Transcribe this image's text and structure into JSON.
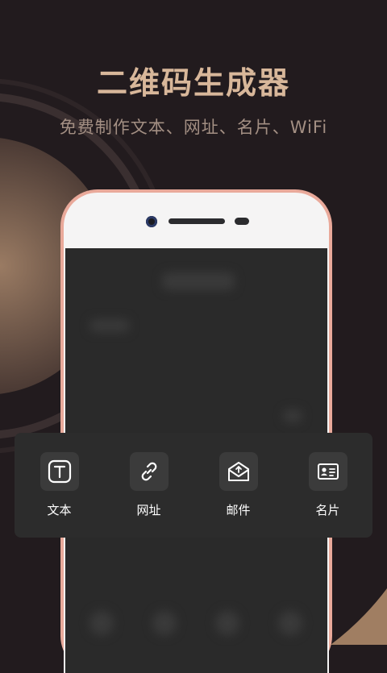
{
  "header": {
    "title": "二维码生成器",
    "subtitle": "免费制作文本、网址、名片、WiFi"
  },
  "colors": {
    "background": "#221b1e",
    "accent_gold": "#d8b79a",
    "phone_frame": "#e9a99a",
    "panel": "#2c2c2c"
  },
  "tools": [
    {
      "label": "文本",
      "icon": "text-t-icon"
    },
    {
      "label": "网址",
      "icon": "link-icon"
    },
    {
      "label": "邮件",
      "icon": "mail-icon"
    },
    {
      "label": "名片",
      "icon": "contact-card-icon"
    }
  ]
}
